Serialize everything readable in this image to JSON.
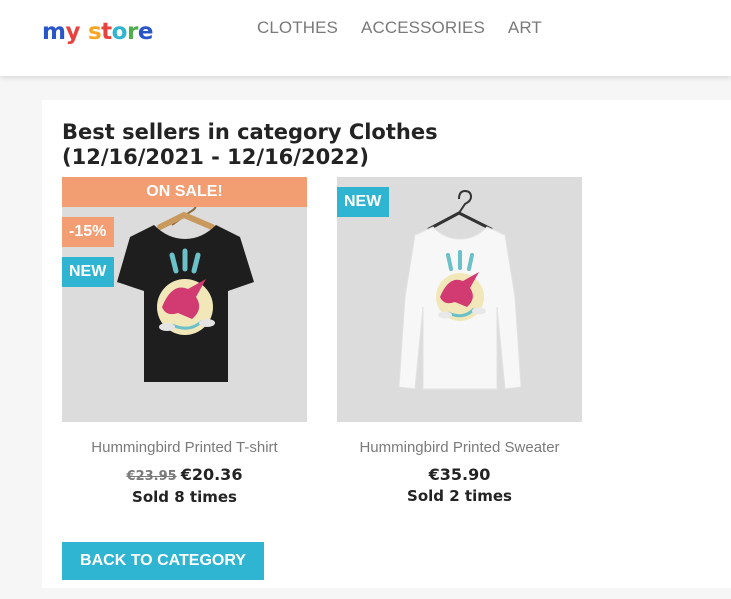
{
  "header": {
    "logo_text": "my store",
    "nav": [
      "CLOTHES",
      "ACCESSORIES",
      "ART"
    ]
  },
  "main": {
    "title_line1": "Best sellers in category Clothes",
    "title_line2": "(12/16/2021 - 12/16/2022)",
    "products": [
      {
        "name": "Hummingbird Printed T-shirt",
        "old_price": "€23.95",
        "price": "€20.36",
        "sold": "Sold 8 times",
        "sale_banner": "ON SALE!",
        "discount": "-15%",
        "badge": "NEW"
      },
      {
        "name": "Hummingbird Printed Sweater",
        "price": "€35.90",
        "sold": "Sold 2 times",
        "badge": "NEW"
      }
    ],
    "back_button": "BACK TO CATEGORY"
  },
  "colors": {
    "accent": "#2fb5d2",
    "sale": "#f39d72",
    "text_dark": "#232323",
    "text_muted": "#7a7a7a"
  }
}
